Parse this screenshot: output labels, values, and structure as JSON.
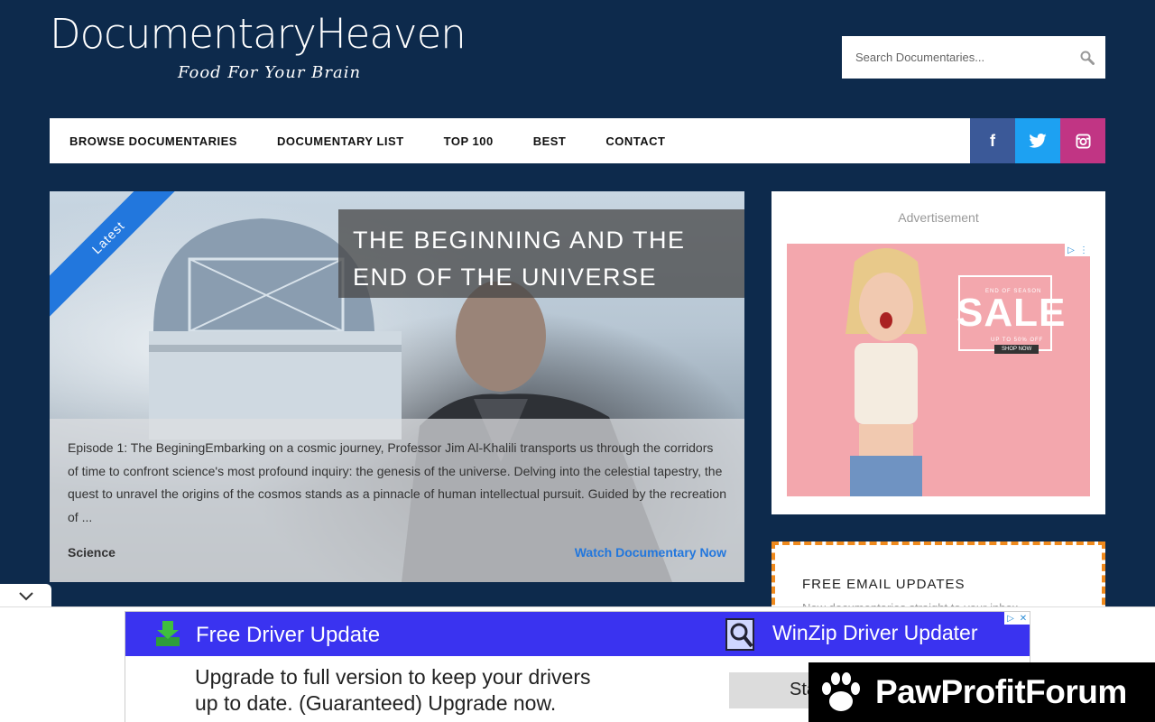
{
  "header": {
    "logo_title": "DocumentaryHeaven",
    "logo_tagline": "Food For Your Brain",
    "search_placeholder": "Search Documentaries..."
  },
  "nav": {
    "items": [
      "BROWSE DOCUMENTARIES",
      "DOCUMENTARY LIST",
      "TOP 100",
      "BEST",
      "CONTACT"
    ],
    "social": {
      "facebook": "f",
      "twitter": "twitter-icon",
      "instagram": "instagram-icon"
    }
  },
  "feature": {
    "ribbon": "Latest",
    "title": "THE BEGINNING AND THE END OF THE UNIVERSE",
    "excerpt": "Episode 1: The BeginingEmbarking on a cosmic journey, Professor Jim Al-Khalili transports us through the corridors of time to confront science's most profound inquiry: the genesis of the universe. Delving into the celestial tapestry, the quest to unravel the origins of the cosmos stands as a pinnacle of human intellectual pursuit. Guided by the recreation of ...",
    "category": "Science",
    "watch_label": "Watch Documentary Now"
  },
  "sidebar": {
    "ad_label": "Advertisement",
    "ad": {
      "small_top": "END OF SEASON",
      "headline": "SALE",
      "small_bottom": "UP TO 50% OFF",
      "button": "SHOP NOW"
    },
    "email": {
      "title": "FREE EMAIL UPDATES",
      "subtitle": "New documentaries straight to your inbox"
    }
  },
  "bottom_ad": {
    "left_title": "Free Driver Update",
    "right_title": "WinZip Driver Updater",
    "body_line1": "Upgrade to full version to keep your drivers",
    "body_line2": "up to date. (Guaranteed) Upgrade now.",
    "button": "Sta"
  },
  "watermark": {
    "text": "PawProfitForum"
  },
  "colors": {
    "background": "#0d2a4c",
    "accent_blue": "#2277dd",
    "facebook": "#3b5998",
    "twitter": "#1da1f2",
    "instagram": "#c13584",
    "email_border": "#f08a1c"
  }
}
